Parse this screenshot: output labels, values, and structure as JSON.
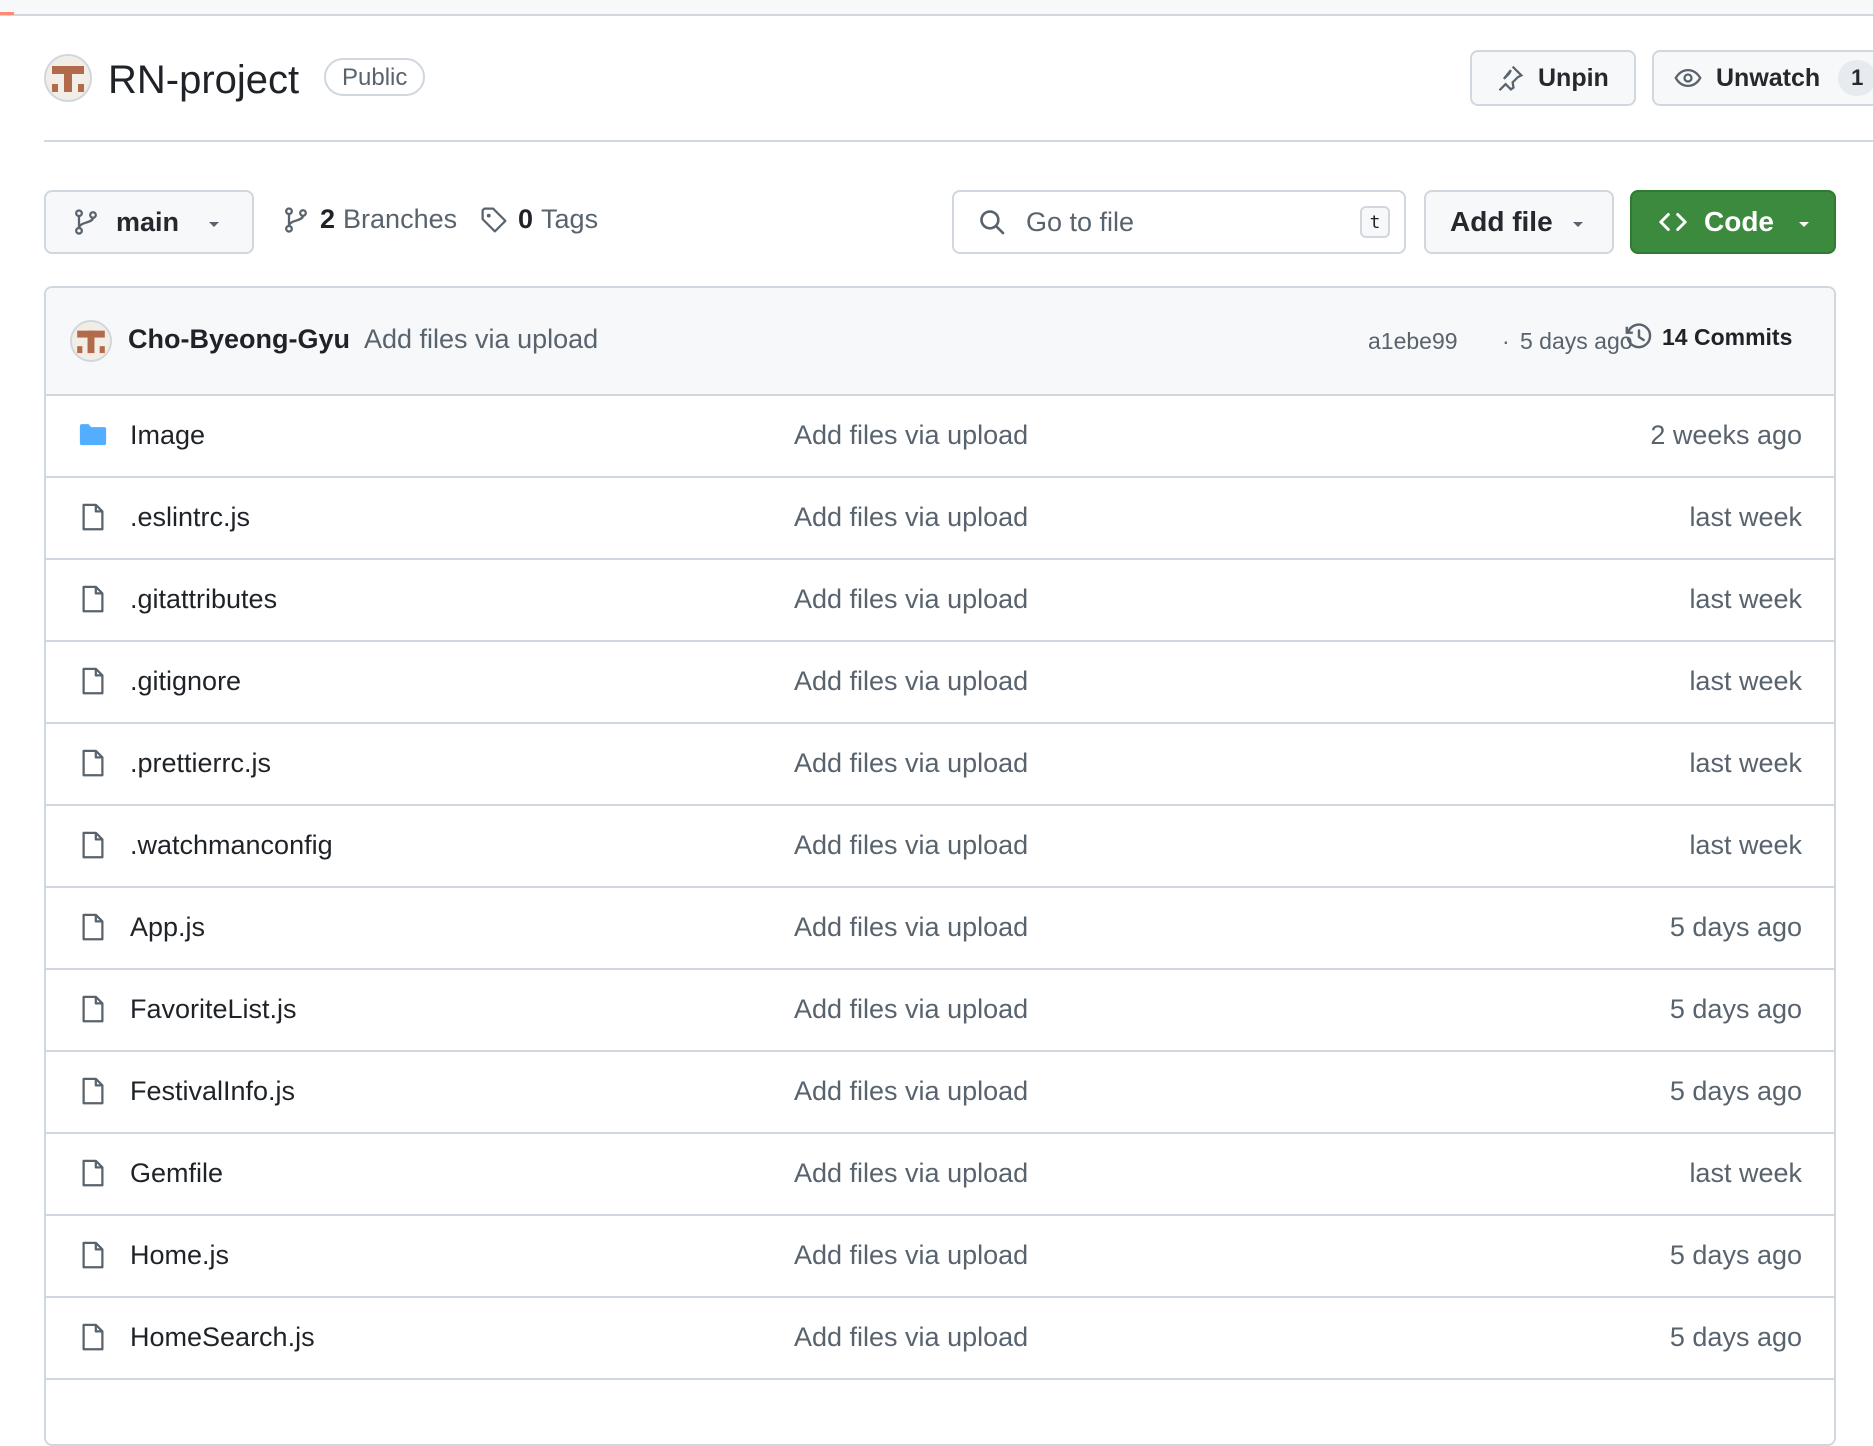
{
  "repo": {
    "name": "RN-project",
    "visibility": "Public"
  },
  "actions": {
    "unpin_label": "Unpin",
    "unwatch_label": "Unwatch",
    "watch_count": "1"
  },
  "toolbar": {
    "branch": "main",
    "branches_count": "2",
    "branches_label": "Branches",
    "tags_count": "0",
    "tags_label": "Tags",
    "search_placeholder": "Go to file",
    "search_shortcut": "t",
    "add_file_label": "Add file",
    "code_label": "Code"
  },
  "latest_commit": {
    "author": "Cho-Byeong-Gyu",
    "message": "Add files via upload",
    "hash": "a1ebe99",
    "separator": "·",
    "time": "5 days ago",
    "commits_label": "14 Commits"
  },
  "files": [
    {
      "type": "folder",
      "name": "Image",
      "message": "Add files via upload",
      "time": "2 weeks ago"
    },
    {
      "type": "file",
      "name": ".eslintrc.js",
      "message": "Add files via upload",
      "time": "last week"
    },
    {
      "type": "file",
      "name": ".gitattributes",
      "message": "Add files via upload",
      "time": "last week"
    },
    {
      "type": "file",
      "name": ".gitignore",
      "message": "Add files via upload",
      "time": "last week"
    },
    {
      "type": "file",
      "name": ".prettierrc.js",
      "message": "Add files via upload",
      "time": "last week"
    },
    {
      "type": "file",
      "name": ".watchmanconfig",
      "message": "Add files via upload",
      "time": "last week"
    },
    {
      "type": "file",
      "name": "App.js",
      "message": "Add files via upload",
      "time": "5 days ago"
    },
    {
      "type": "file",
      "name": "FavoriteList.js",
      "message": "Add files via upload",
      "time": "5 days ago"
    },
    {
      "type": "file",
      "name": "FestivalInfo.js",
      "message": "Add files via upload",
      "time": "5 days ago"
    },
    {
      "type": "file",
      "name": "Gemfile",
      "message": "Add files via upload",
      "time": "last week"
    },
    {
      "type": "file",
      "name": "Home.js",
      "message": "Add files via upload",
      "time": "5 days ago"
    },
    {
      "type": "file",
      "name": "HomeSearch.js",
      "message": "Add files via upload",
      "time": "5 days ago"
    }
  ],
  "colors": {
    "code_button": "#3c8a3e",
    "folder_icon": "#54aeff",
    "border": "#d0d7de",
    "muted_text": "#59636e"
  },
  "icons": {
    "pin": "pin-icon",
    "eye": "eye-icon",
    "branch": "git-branch-icon",
    "tag": "tag-icon",
    "search": "search-icon",
    "code": "code-icon",
    "history": "history-icon",
    "folder": "folder-icon",
    "file": "file-icon"
  }
}
